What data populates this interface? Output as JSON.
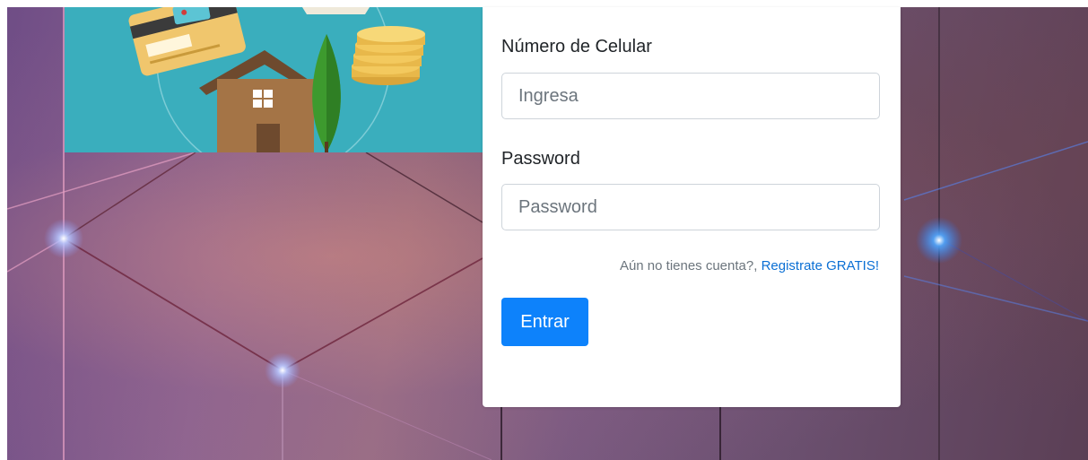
{
  "form": {
    "phone_label": "Número de Celular",
    "phone_placeholder": "Ingresa",
    "password_label": "Password",
    "password_placeholder": "Password",
    "register_prompt": "Aún no tienes cuenta?,",
    "register_link": "Registrate GRATIS!",
    "submit_label": "Entrar"
  },
  "colors": {
    "primary_button": "#0d82fb",
    "link": "#0a6fd4",
    "illustration_bg": "#3aaebd"
  },
  "icons": [
    "credit-card-icon",
    "house-icon",
    "tree-icon",
    "coins-icon",
    "envelope-icon"
  ]
}
